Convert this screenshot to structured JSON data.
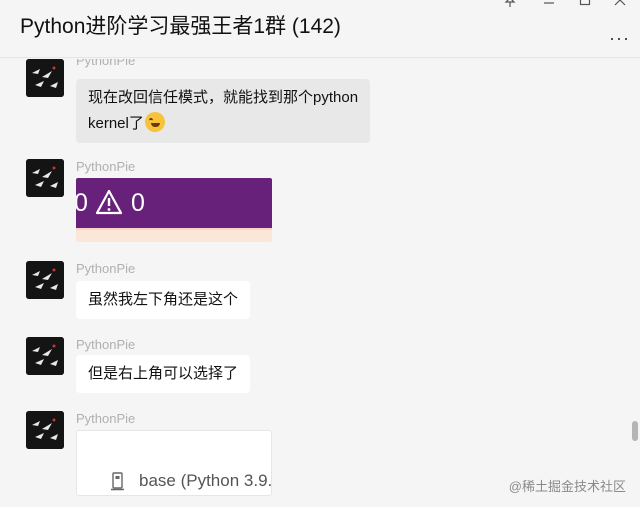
{
  "window": {
    "title": "Python进阶学习最强王者1群 (142)",
    "more_label": "···"
  },
  "messages": [
    {
      "sender": "PythonPie",
      "text_line1": "现在改回信任模式，就能找到那个python",
      "text_line2": "kernel了",
      "emoji": "face-with-tears-of-joy"
    },
    {
      "sender": "PythonPie",
      "image_text_a": "0",
      "image_text_b": "0"
    },
    {
      "sender": "PythonPie",
      "text": "虽然我左下角还是这个"
    },
    {
      "sender": "PythonPie",
      "text": "但是右上角可以选择了"
    },
    {
      "sender": "PythonPie",
      "image_text": "base (Python 3.9."
    }
  ],
  "watermark": "@稀土掘金技术社区",
  "colors": {
    "bg": "#f5f5f5",
    "bubble": "#ffffff",
    "bubble_grey": "#e8e8e8",
    "statusbar_purple": "#68217a"
  }
}
